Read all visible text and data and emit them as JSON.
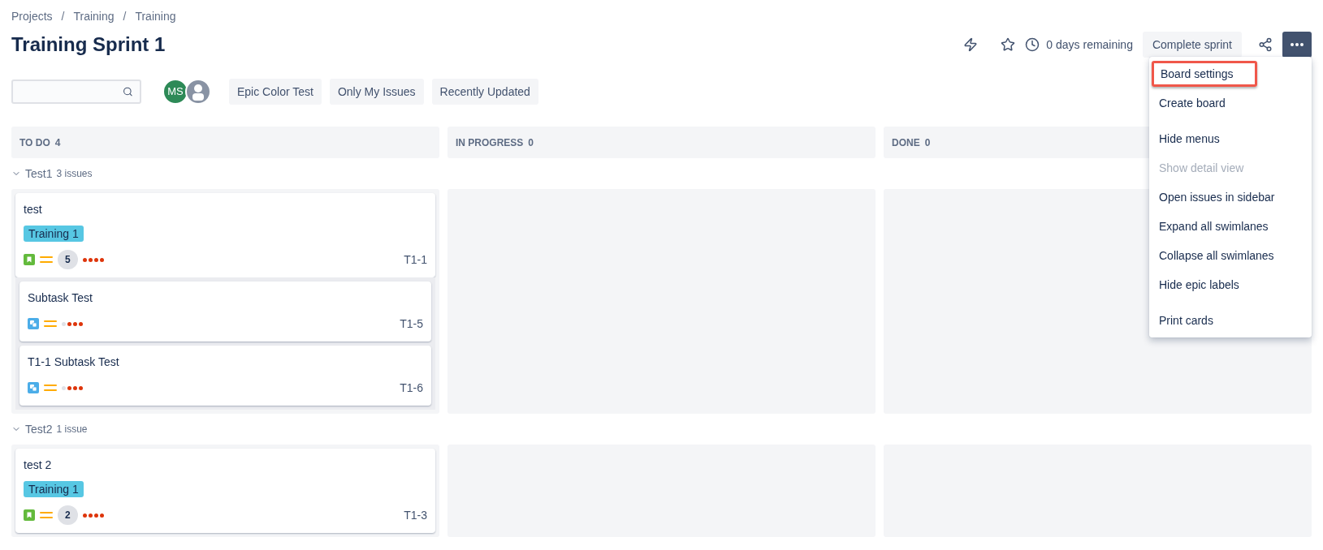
{
  "breadcrumbs": [
    {
      "kind": "link",
      "text": "Projects"
    },
    {
      "kind": "separator",
      "text": "/"
    },
    {
      "kind": "link",
      "text": "Training"
    },
    {
      "kind": "separator",
      "text": "/"
    },
    {
      "kind": "link",
      "text": "Training"
    }
  ],
  "title": "Training Sprint 1",
  "header": {
    "remaining": "0 days remaining",
    "complete_button": "Complete sprint"
  },
  "avatars": [
    {
      "kind": "initials",
      "label": "MS",
      "color": "#2d8a57"
    },
    {
      "kind": "silhouette",
      "color": "#8993a4"
    }
  ],
  "filters": [
    {
      "label": "Epic Color Test",
      "selected": false
    },
    {
      "label": "Only My Issues",
      "selected": false
    },
    {
      "label": "Recently Updated",
      "selected": false
    }
  ],
  "columns": [
    {
      "name": "TO DO",
      "count": "4"
    },
    {
      "name": "IN PROGRESS",
      "count": "0"
    },
    {
      "name": "DONE",
      "count": "0"
    }
  ],
  "swimlanes": [
    {
      "name": "Test1",
      "count": "3 issues",
      "expanded": true,
      "cards": [
        {
          "kind": "story",
          "title": "test",
          "epic": {
            "label": "Training 1",
            "color": "#57c7e3"
          },
          "estimate": "5",
          "dots": [
            true,
            true,
            true,
            true
          ],
          "key": "T1-1",
          "subtasks": [
            {
              "kind": "subtask",
              "title": "Subtask Test",
              "dots": [
                false,
                true,
                true,
                true
              ],
              "key": "T1-5"
            },
            {
              "kind": "subtask",
              "title": "T1-1 Subtask Test",
              "dots": [
                false,
                true,
                true,
                true
              ],
              "key": "T1-6"
            }
          ]
        }
      ]
    },
    {
      "name": "Test2",
      "count": "1 issue",
      "expanded": true,
      "cards": [
        {
          "kind": "story",
          "title": "test 2",
          "epic": {
            "label": "Training 1",
            "color": "#57c7e3"
          },
          "estimate": "2",
          "dots": [
            true,
            true,
            true,
            true
          ],
          "key": "T1-3"
        }
      ]
    }
  ],
  "menu": [
    [
      {
        "label": "Board settings",
        "selected": true,
        "disabled": false
      },
      {
        "label": "Create board",
        "selected": false,
        "disabled": false
      }
    ],
    [
      {
        "label": "Hide menus",
        "selected": false,
        "disabled": false
      },
      {
        "label": "Show detail view",
        "selected": false,
        "disabled": true
      },
      {
        "label": "Open issues in sidebar",
        "selected": false,
        "disabled": false
      },
      {
        "label": "Expand all swimlanes",
        "selected": false,
        "disabled": false
      },
      {
        "label": "Collapse all swimlanes",
        "selected": false,
        "disabled": false
      },
      {
        "label": "Hide epic labels",
        "selected": false,
        "disabled": false
      }
    ],
    [
      {
        "label": "Print cards",
        "selected": false,
        "disabled": false
      }
    ]
  ]
}
